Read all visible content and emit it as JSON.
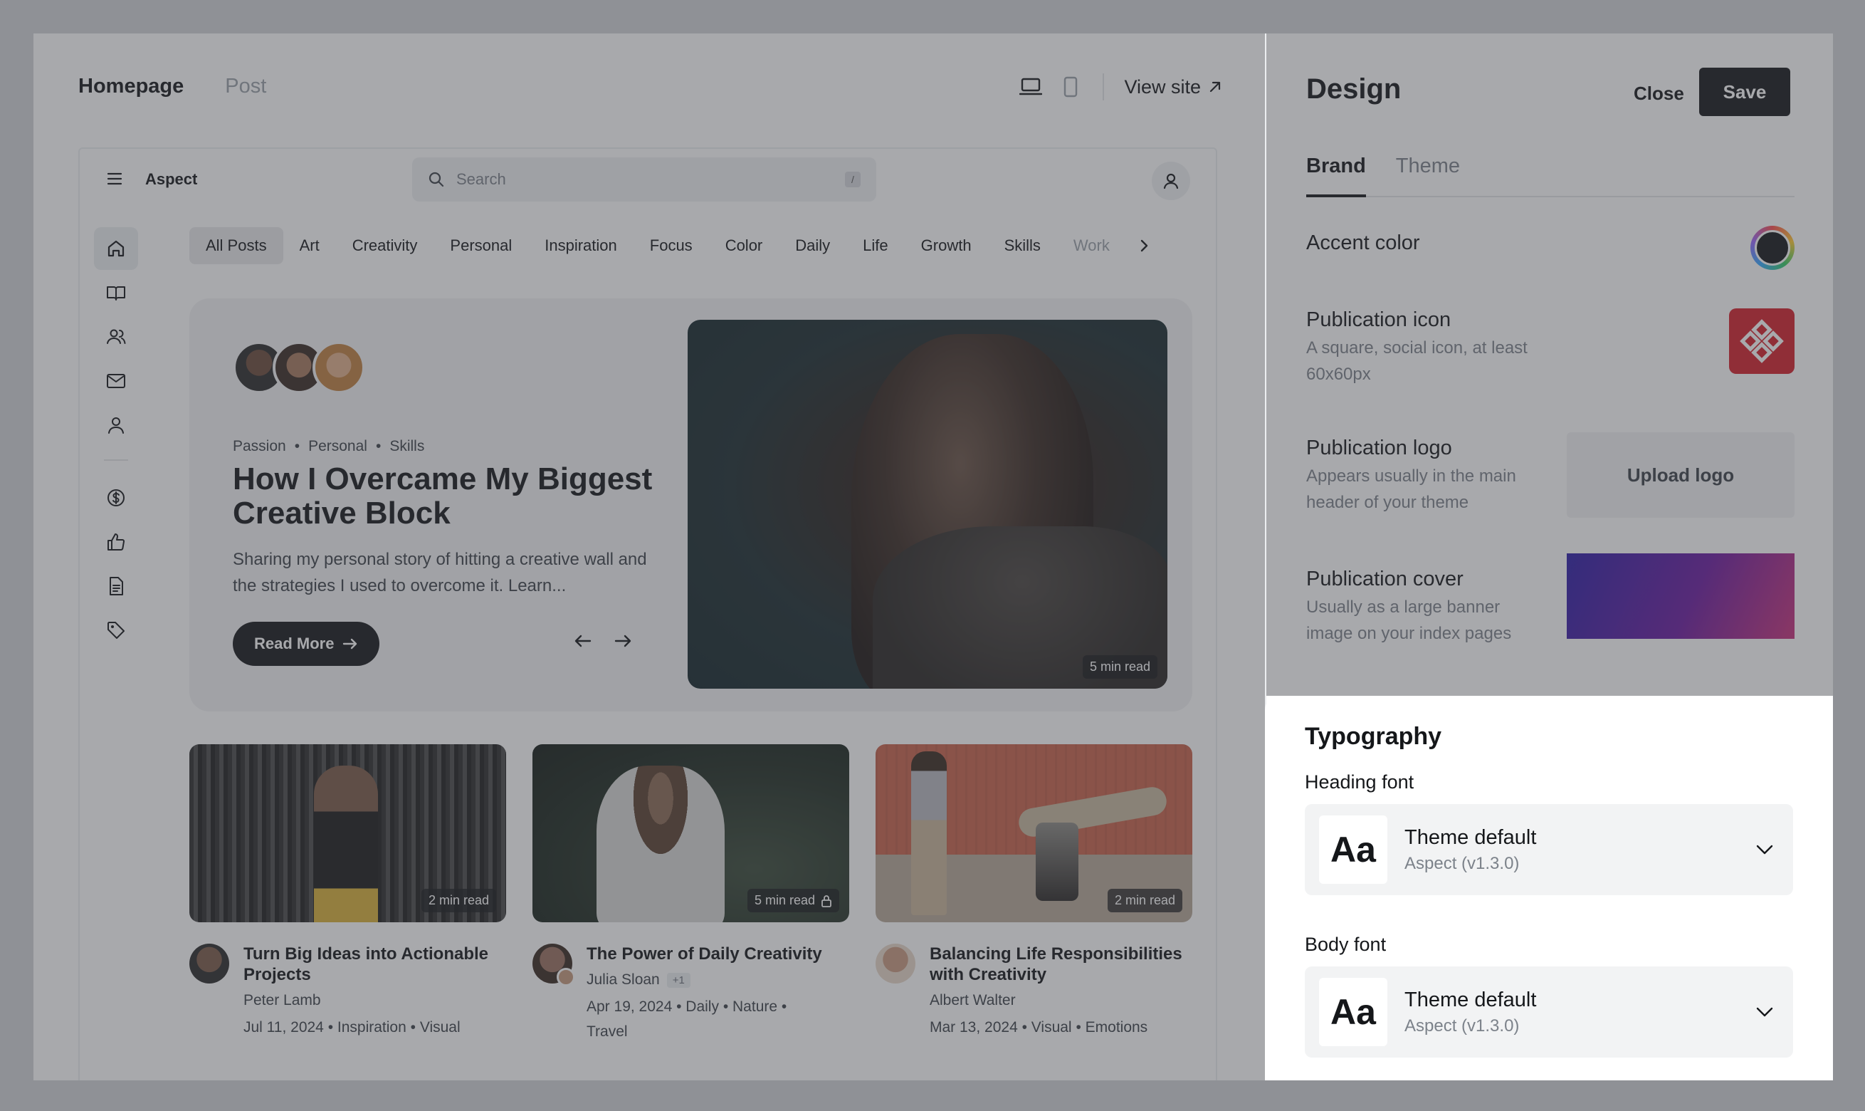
{
  "preview": {
    "tabs": [
      "Homepage",
      "Post"
    ],
    "view_site": "View site",
    "site": {
      "brand": "Aspect",
      "search_placeholder": "Search",
      "search_shortcut": "/",
      "categories": [
        "All Posts",
        "Art",
        "Creativity",
        "Personal",
        "Inspiration",
        "Focus",
        "Color",
        "Daily",
        "Life",
        "Growth",
        "Skills",
        "Work"
      ],
      "hero": {
        "tags": [
          "Passion",
          "Personal",
          "Skills"
        ],
        "title": "How I Overcame My Biggest Creative Block",
        "excerpt": "Sharing my personal story of hitting a creative wall and the strategies I used to overcome it. Learn...",
        "button": "Read More",
        "badge": "5 min read"
      },
      "cards": [
        {
          "badge": "2 min read",
          "title": "Turn Big Ideas into Actionable Projects",
          "author": "Peter Lamb",
          "extra": "",
          "date": "Jul 11, 2024",
          "tags": [
            "Inspiration",
            "Visual"
          ]
        },
        {
          "badge": "5 min read",
          "title": "The Power of Daily Creativity",
          "author": "Julia Sloan",
          "extra": "+1",
          "date": "Apr 19, 2024",
          "tags": [
            "Daily",
            "Nature",
            "Travel"
          ]
        },
        {
          "badge": "2 min read",
          "title": "Balancing Life Responsibilities with Creativity",
          "author": "Albert Walter",
          "extra": "",
          "date": "Mar 13, 2024",
          "tags": [
            "Visual",
            "Emotions"
          ]
        }
      ]
    }
  },
  "panel": {
    "title": "Design",
    "close": "Close",
    "save": "Save",
    "tabs": [
      "Brand",
      "Theme"
    ],
    "accent": {
      "label": "Accent color",
      "color": "#15171a"
    },
    "pub_icon": {
      "label": "Publication icon",
      "desc": "A square, social icon, at least 60x60px",
      "color": "#d41f2b"
    },
    "pub_logo": {
      "label": "Publication logo",
      "desc": "Appears usually in the main header of your theme",
      "button": "Upload logo"
    },
    "pub_cover": {
      "label": "Publication cover",
      "desc": "Usually as a large banner image on your index pages"
    },
    "typography": {
      "title": "Typography",
      "heading": {
        "label": "Heading font",
        "sample": "Aa",
        "name": "Theme default",
        "sub": "Aspect (v1.3.0)"
      },
      "body": {
        "label": "Body font",
        "sample": "Aa",
        "name": "Theme default",
        "sub": "Aspect (v1.3.0)"
      }
    }
  }
}
